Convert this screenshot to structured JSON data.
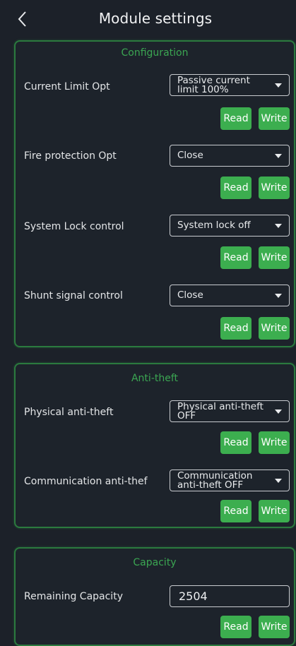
{
  "header": {
    "title": "Module settings"
  },
  "configuration": {
    "title": "Configuration",
    "rows": [
      {
        "label": "Current Limit Opt",
        "value": "Passive current limit 100%"
      },
      {
        "label": "Fire protection Opt",
        "value": "Close"
      },
      {
        "label": "System Lock control",
        "value": "System lock off"
      },
      {
        "label": "Shunt signal control",
        "value": "Close"
      }
    ]
  },
  "anti_theft": {
    "title": "Anti-theft",
    "rows": [
      {
        "label": "Physical anti-theft",
        "value": "Physical anti-theft OFF"
      },
      {
        "label": "Communication anti-thef",
        "value": "Communication anti-theft OFF"
      }
    ]
  },
  "capacity": {
    "title": "Capacity",
    "rows": [
      {
        "label": "Remaining Capacity",
        "value": "2504"
      }
    ]
  },
  "buttons": {
    "read": "Read",
    "write": "Write"
  },
  "colors": {
    "accent": "#3cae4f",
    "border": "#2b7a3e",
    "background": "#1c2129"
  },
  "icons": {
    "back": "chevron-left-icon",
    "dropdown": "caret-down-icon"
  }
}
